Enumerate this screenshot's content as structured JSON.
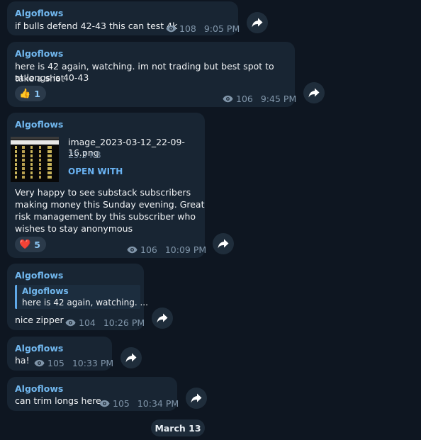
{
  "messages": [
    {
      "sender": "Algoflows",
      "text": "if bulls defend  42-43 this can test 4k",
      "views": "108",
      "time": "9:05 PM"
    },
    {
      "sender": "Algoflows",
      "text_line1": "here is 42 again, watching. im not trading but best spot to take a shot",
      "text_line2": "at longs is 40-43",
      "reaction_emoji": "👍",
      "reaction_count": "1",
      "views": "106",
      "time": "9:45 PM"
    },
    {
      "sender": "Algoflows",
      "file_name": "image_2023-03-12_22-09-16.png",
      "file_size": "25.3 KB",
      "open_with": "OPEN WITH",
      "text_line1": "Very happy to see substack subscribers",
      "text_line2": "making money this Sunday evening. Great",
      "text_line3": "risk management by this subscriber who",
      "text_line4": "wishes to stay anonymous",
      "reaction_emoji": "❤️",
      "reaction_count": "5",
      "views": "106",
      "time": "10:09 PM"
    },
    {
      "sender": "Algoflows",
      "reply_sender": "Algoflows",
      "reply_text": "here is 42 again, watching. ...",
      "text": "nice zipper",
      "views": "104",
      "time": "10:26 PM"
    },
    {
      "sender": "Algoflows",
      "text": "ha!",
      "views": "105",
      "time": "10:33 PM"
    },
    {
      "sender": "Algoflows",
      "text": "can trim longs here",
      "views": "105",
      "time": "10:34 PM"
    }
  ],
  "date_separator": "March 13",
  "icons": {
    "views": "eye-icon",
    "forward": "forward-arrow-icon"
  },
  "colors": {
    "background": "#0e1621",
    "bubble": "#182533",
    "accent": "#71b7ee",
    "meta": "#8196aa"
  }
}
